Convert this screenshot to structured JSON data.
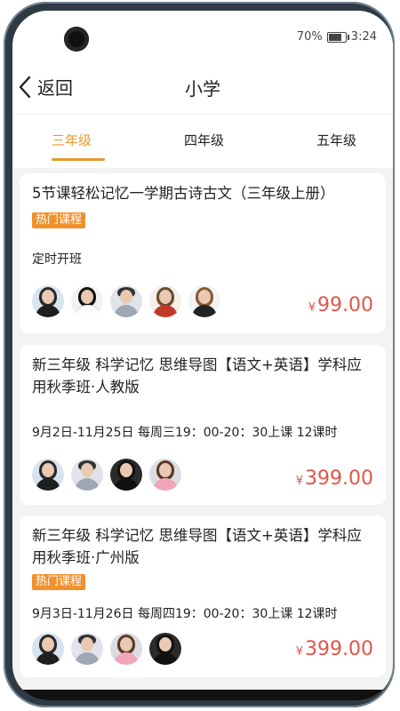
{
  "status_bar": {
    "battery": "70%",
    "time": "3:24"
  },
  "nav": {
    "back_label": "返回",
    "title": "小学"
  },
  "tabs": [
    {
      "label": "三年级",
      "active": true
    },
    {
      "label": "四年级",
      "active": false
    },
    {
      "label": "五年级",
      "active": false
    }
  ],
  "courses": [
    {
      "title": "5节课轻松记忆一学期古诗古文（三年级上册）",
      "badge": "热门课程",
      "schedule": "定时开班",
      "currency": "¥",
      "price": "99.00",
      "teacher_avatars": [
        "teacher-avatar-icon",
        "teacher-avatar-icon",
        "teacher-avatar-icon",
        "teacher-avatar-icon",
        "teacher-avatar-icon"
      ]
    },
    {
      "title": "新三年级 科学记忆 思维导图【语文+英语】学科应用秋季班·人教版",
      "badge": "",
      "schedule": "9月2日-11月25日 每周三19：00-20：30上课 12课时",
      "currency": "¥",
      "price": "399.00",
      "teacher_avatars": [
        "teacher-avatar-icon",
        "teacher-avatar-icon",
        "teacher-avatar-icon",
        "teacher-avatar-icon"
      ]
    },
    {
      "title": "新三年级 科学记忆 思维导图【语文+英语】学科应用秋季班·广州版",
      "badge": "热门课程",
      "schedule": "9月3日-11月26日 每周四19：00-20：30上课 12课时",
      "currency": "¥",
      "price": "399.00",
      "teacher_avatars": [
        "teacher-avatar-icon",
        "teacher-avatar-icon",
        "teacher-avatar-icon",
        "teacher-avatar-icon"
      ]
    }
  ],
  "colors": {
    "accent": "#e89a2d",
    "price": "#e2554a",
    "badge": "#f0912e"
  }
}
